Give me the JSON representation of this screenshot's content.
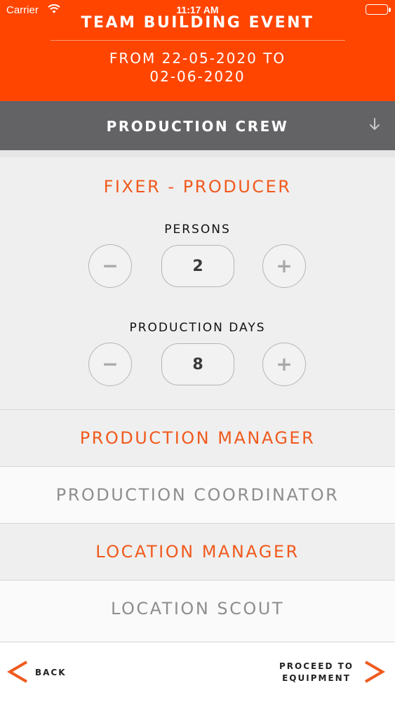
{
  "status_bar": {
    "carrier": "Carrier",
    "time": "11:17 AM"
  },
  "header": {
    "title": "TEAM BUILDING EVENT",
    "dates_line1": "FROM 22-05-2020 TO",
    "dates_line2": "02-06-2020"
  },
  "section": {
    "title": "PRODUCTION CREW",
    "toggle_icon": "arrow-down-icon"
  },
  "expanded_role": {
    "title": "FIXER - PRODUCER",
    "persons_label": "PERSONS",
    "persons_value": "2",
    "days_label": "PRODUCTION DAYS",
    "days_value": "8",
    "minus": "−",
    "plus": "+"
  },
  "roles": [
    {
      "label": "PRODUCTION MANAGER"
    },
    {
      "label": "PRODUCTION COORDINATOR"
    },
    {
      "label": "LOCATION MANAGER"
    },
    {
      "label": "LOCATION SCOUT"
    }
  ],
  "footer": {
    "back_label": "BACK",
    "proceed_line1": "PROCEED TO",
    "proceed_line2": "EQUIPMENT"
  },
  "colors": {
    "header": "#ff4500",
    "section_bar": "#636366",
    "accent": "#f05a1e",
    "muted": "#8e8e8e"
  }
}
